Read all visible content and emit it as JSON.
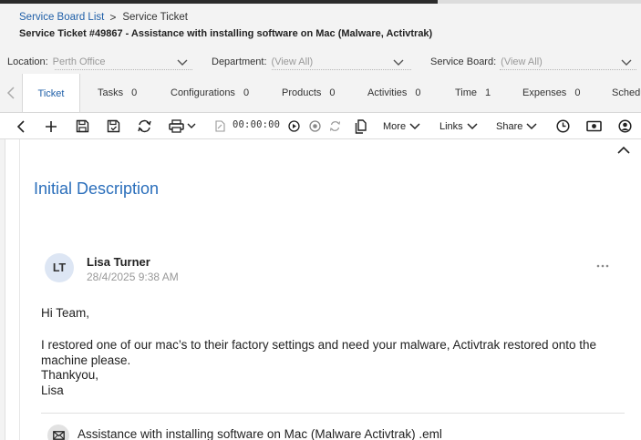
{
  "breadcrumb": {
    "parent": "Service Board List",
    "current": "Service Ticket"
  },
  "ticket": {
    "title": "Service Ticket #49867 - Assistance with installing software on Mac (Malware, Activtrak)"
  },
  "filters": {
    "location_label": "Location:",
    "location_value": "Perth Office",
    "department_label": "Department:",
    "department_value": "(View All)",
    "board_label": "Service Board:",
    "board_value": "(View All)"
  },
  "tabs": [
    {
      "label": "Ticket",
      "count": ""
    },
    {
      "label": "Tasks",
      "count": "0"
    },
    {
      "label": "Configurations",
      "count": "0"
    },
    {
      "label": "Products",
      "count": "0"
    },
    {
      "label": "Activities",
      "count": "0"
    },
    {
      "label": "Time",
      "count": "1"
    },
    {
      "label": "Expenses",
      "count": "0"
    },
    {
      "label": "Schedu",
      "count": ""
    }
  ],
  "toolbar": {
    "timer": "00:00:00",
    "more_label": "More",
    "links_label": "Links",
    "share_label": "Share"
  },
  "section": {
    "title": "Initial Description"
  },
  "note": {
    "initials": "LT",
    "author": "Lisa Turner",
    "timestamp": "28/4/2025 9:38 AM",
    "greeting": "Hi Team,",
    "body_line1": "I restored one of our mac’s to their factory settings and need your malware, Activtrak restored onto the",
    "body_line2": "machine please.",
    "closing": "Thankyou,",
    "signature": "Lisa",
    "attachment": "Assistance with installing software on Mac (Malware Activtrak) .eml"
  },
  "colors": {
    "accent": "#2a6ebb",
    "link": "#1f5fa8",
    "header_bg": "#f3f3f3"
  }
}
